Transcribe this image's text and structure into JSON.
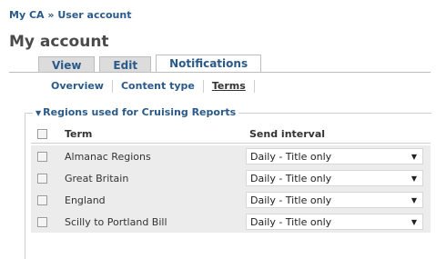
{
  "breadcrumb": {
    "home": "My CA",
    "separator": "»",
    "current": "User account"
  },
  "page_title": "My account",
  "tabs_primary": [
    {
      "label": "View",
      "active": false
    },
    {
      "label": "Edit",
      "active": false
    },
    {
      "label": "Notifications",
      "active": true
    }
  ],
  "tabs_secondary": [
    {
      "label": "Overview",
      "active": false
    },
    {
      "label": "Content type",
      "active": false
    },
    {
      "label": "Terms",
      "active": true
    }
  ],
  "fieldset": {
    "legend": "Regions used for Cruising Reports",
    "columns": {
      "term": "Term",
      "interval": "Send interval"
    },
    "rows": [
      {
        "term": "Almanac Regions",
        "interval": "Daily - Title only"
      },
      {
        "term": "Great Britain",
        "interval": "Daily - Title only"
      },
      {
        "term": "England",
        "interval": "Daily - Title only"
      },
      {
        "term": "Scilly to Portland Bill",
        "interval": "Daily - Title only"
      }
    ]
  },
  "colors": {
    "link": "#2a5a8a",
    "row_bg": "#ececec"
  }
}
